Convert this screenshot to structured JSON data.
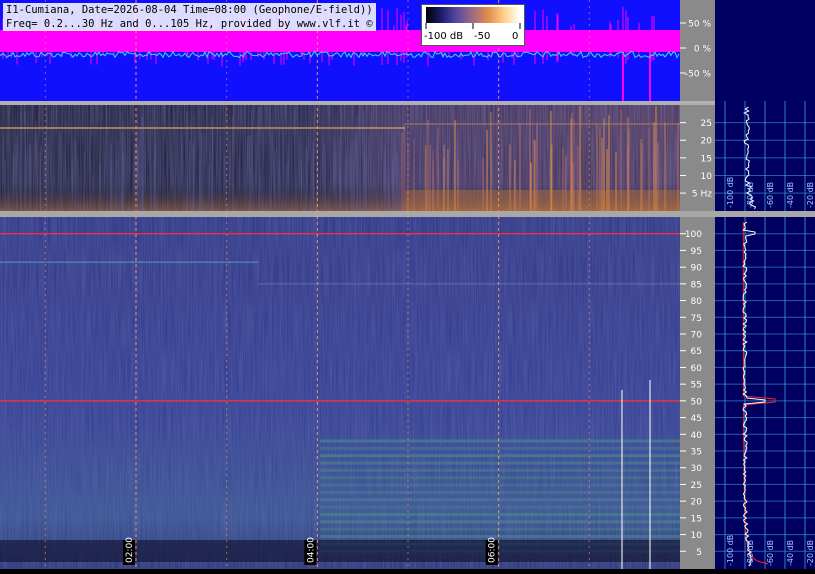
{
  "title": {
    "line1": "I1-Cumiana, Date=2026-08-04 Time=08:00 (Geophone/E-field))",
    "line2": "Freq= 0.2...30 Hz and 0...105 Hz, provided by www.vlf.it ©"
  },
  "colorbar": {
    "labels": [
      "-100 dB",
      "-50",
      "0"
    ],
    "stops": [
      "#000000",
      "#1a1f6e",
      "#5a4aa0",
      "#a06a80",
      "#e0904a",
      "#ffd08a",
      "#ffffff"
    ]
  },
  "colors": {
    "amplitude_bg": "#1010ff",
    "amplitude_envelope": "#ff00ff",
    "amplitude_trace": "#30e0e0",
    "spectrogram_bg": "#2a2f7a",
    "gridline": "#ff9966",
    "mains_line": "#ff3030",
    "axis_panel": "#8a8a8a",
    "spectrum_bg": "#000060",
    "spectrum_grid": "#3aa0e0",
    "spectrum_trace": "#ffffff",
    "spectrum_fit": "#ff2020"
  },
  "chart_data": [
    {
      "type": "line",
      "panel": "amplitude",
      "y_ticks": [
        "50 %",
        "0 %",
        "-50 %"
      ],
      "y_values": [
        50,
        0,
        -50
      ],
      "ylim": [
        -100,
        100
      ]
    },
    {
      "type": "heatmap",
      "panel": "spectrogram-low",
      "y_ticks": [
        "25",
        "20",
        "15",
        "10",
        "5 Hz"
      ],
      "y_values": [
        25,
        20,
        15,
        10,
        5
      ],
      "ylim": [
        0.2,
        30
      ]
    },
    {
      "type": "heatmap",
      "panel": "spectrogram-high",
      "y_ticks": [
        "100",
        "95",
        "90",
        "85",
        "80",
        "75",
        "70",
        "65",
        "60",
        "55",
        "50",
        "45",
        "40",
        "35",
        "30",
        "25",
        "20",
        "15",
        "10",
        "5"
      ],
      "y_values": [
        100,
        95,
        90,
        85,
        80,
        75,
        70,
        65,
        60,
        55,
        50,
        45,
        40,
        35,
        30,
        25,
        20,
        15,
        10,
        5
      ],
      "ylim": [
        0,
        105
      ],
      "x_ticks": [
        "02:00",
        "04:00",
        "06:00"
      ],
      "x_values": [
        2,
        4,
        6
      ],
      "xlim": [
        0.5,
        8
      ],
      "lines_hz": [
        50,
        100
      ]
    },
    {
      "type": "line",
      "panel": "spectrum",
      "x_ticks": [
        "-100 dB",
        "-80 dB",
        "-60 dB",
        "-40 dB",
        "-20 dB"
      ],
      "x_values": [
        -100,
        -80,
        -60,
        -40,
        -20
      ],
      "xlim": [
        -110,
        -10
      ],
      "peaks_hz": [
        50,
        100
      ]
    }
  ]
}
